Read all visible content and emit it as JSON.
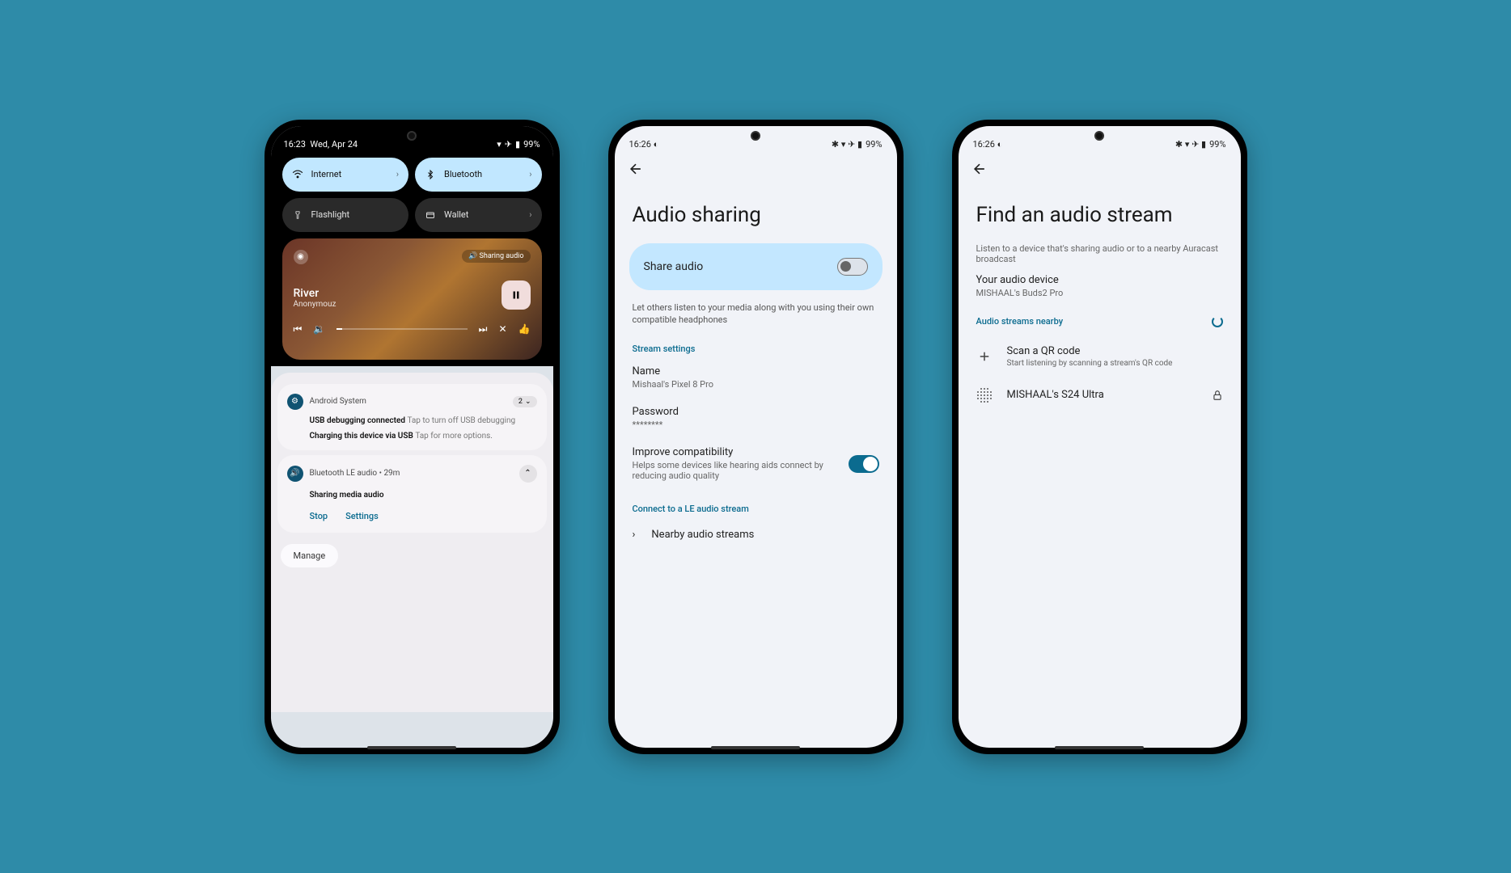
{
  "phone1": {
    "status": {
      "time": "16:23",
      "date": "Wed, Apr 24",
      "battery": "99%"
    },
    "qs": {
      "internet": "Internet",
      "bluetooth": "Bluetooth",
      "flashlight": "Flashlight",
      "wallet": "Wallet"
    },
    "media": {
      "badge": "Sharing audio",
      "title": "River",
      "artist": "Anonymouz"
    },
    "notifs": {
      "system_src": "Android System",
      "system_count": "2",
      "usb_bold": "USB debugging connected",
      "usb_hint": "Tap to turn off USB debugging",
      "charge_bold": "Charging this device via USB",
      "charge_hint": "Tap for more options.",
      "ble_src": "Bluetooth LE audio",
      "ble_time": "29m",
      "ble_title": "Sharing media audio",
      "stop": "Stop",
      "settings": "Settings",
      "manage": "Manage"
    }
  },
  "phone2": {
    "status": {
      "time": "16:26",
      "battery": "99%"
    },
    "title": "Audio sharing",
    "share_label": "Share audio",
    "share_desc": "Let others listen to your media along with you using their own compatible headphones",
    "stream_section": "Stream settings",
    "name_label": "Name",
    "name_value": "Mishaal's Pixel 8 Pro",
    "password_label": "Password",
    "password_value": "********",
    "compat_label": "Improve compatibility",
    "compat_desc": "Helps some devices like hearing aids connect by reducing audio quality",
    "connect_section": "Connect to a LE audio stream",
    "nearby": "Nearby audio streams"
  },
  "phone3": {
    "status": {
      "time": "16:26",
      "battery": "99%"
    },
    "title": "Find an audio stream",
    "desc": "Listen to a device that's sharing audio or to a nearby Auracast broadcast",
    "device_label": "Your audio device",
    "device_value": "MISHAAL's Buds2 Pro",
    "streams_label": "Audio streams nearby",
    "scan_label": "Scan a QR code",
    "scan_desc": "Start listening by scanning a stream's QR code",
    "stream_name": "MISHAAL's S24 Ultra"
  }
}
